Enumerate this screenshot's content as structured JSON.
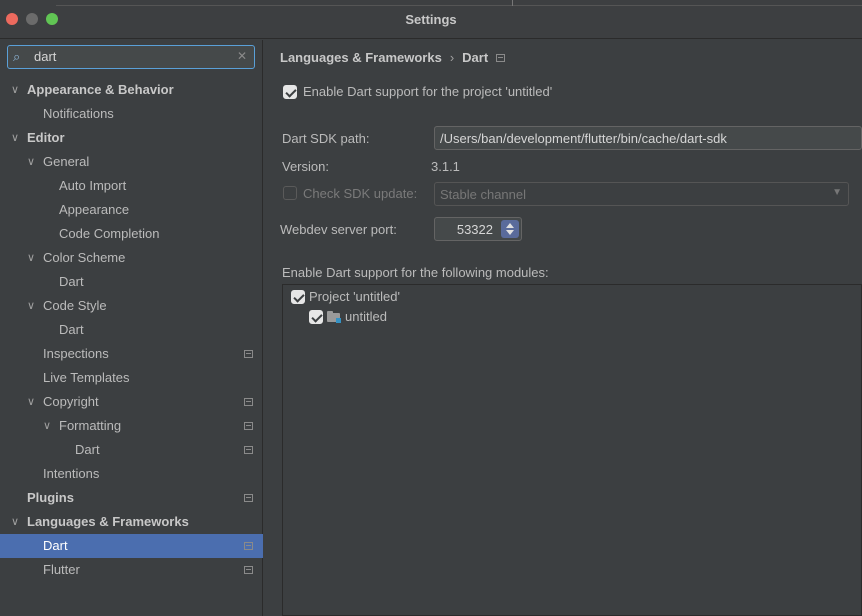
{
  "window": {
    "title": "Settings"
  },
  "search": {
    "value": "dart",
    "placeholder": ""
  },
  "sidebar": {
    "items": [
      {
        "label": "Appearance & Behavior"
      },
      {
        "label": "Notifications"
      },
      {
        "label": "Editor"
      },
      {
        "label": "General"
      },
      {
        "label": "Auto Import"
      },
      {
        "label": "Appearance"
      },
      {
        "label": "Code Completion"
      },
      {
        "label": "Color Scheme"
      },
      {
        "label": "Dart"
      },
      {
        "label": "Code Style"
      },
      {
        "label": "Dart"
      },
      {
        "label": "Inspections"
      },
      {
        "label": "Live Templates"
      },
      {
        "label": "Copyright"
      },
      {
        "label": "Formatting"
      },
      {
        "label": "Dart"
      },
      {
        "label": "Intentions"
      },
      {
        "label": "Plugins"
      },
      {
        "label": "Languages & Frameworks"
      },
      {
        "label": "Dart"
      },
      {
        "label": "Flutter"
      }
    ]
  },
  "breadcrumb": {
    "parent": "Languages & Frameworks",
    "separator": "›",
    "current": "Dart"
  },
  "form": {
    "enable_label": "Enable Dart support for the project 'untitled'",
    "sdk_path_label": "Dart SDK path:",
    "sdk_path_value": "/Users/ban/development/flutter/bin/cache/dart-sdk",
    "version_label": "Version:",
    "version_value": "3.1.1",
    "check_update_label": "Check SDK update:",
    "channel_value": "Stable channel",
    "webdev_label": "Webdev server port:",
    "webdev_value": "53322",
    "modules_label": "Enable Dart support for the following modules:",
    "modules": [
      {
        "label": "Project 'untitled'"
      },
      {
        "label": "untitled"
      }
    ]
  },
  "icons": {
    "search": "search-icon",
    "clear": "clear-icon",
    "chevron_down": "chevron-down-icon",
    "project_scope": "project-scope-icon",
    "module_folder": "module-folder-icon"
  }
}
